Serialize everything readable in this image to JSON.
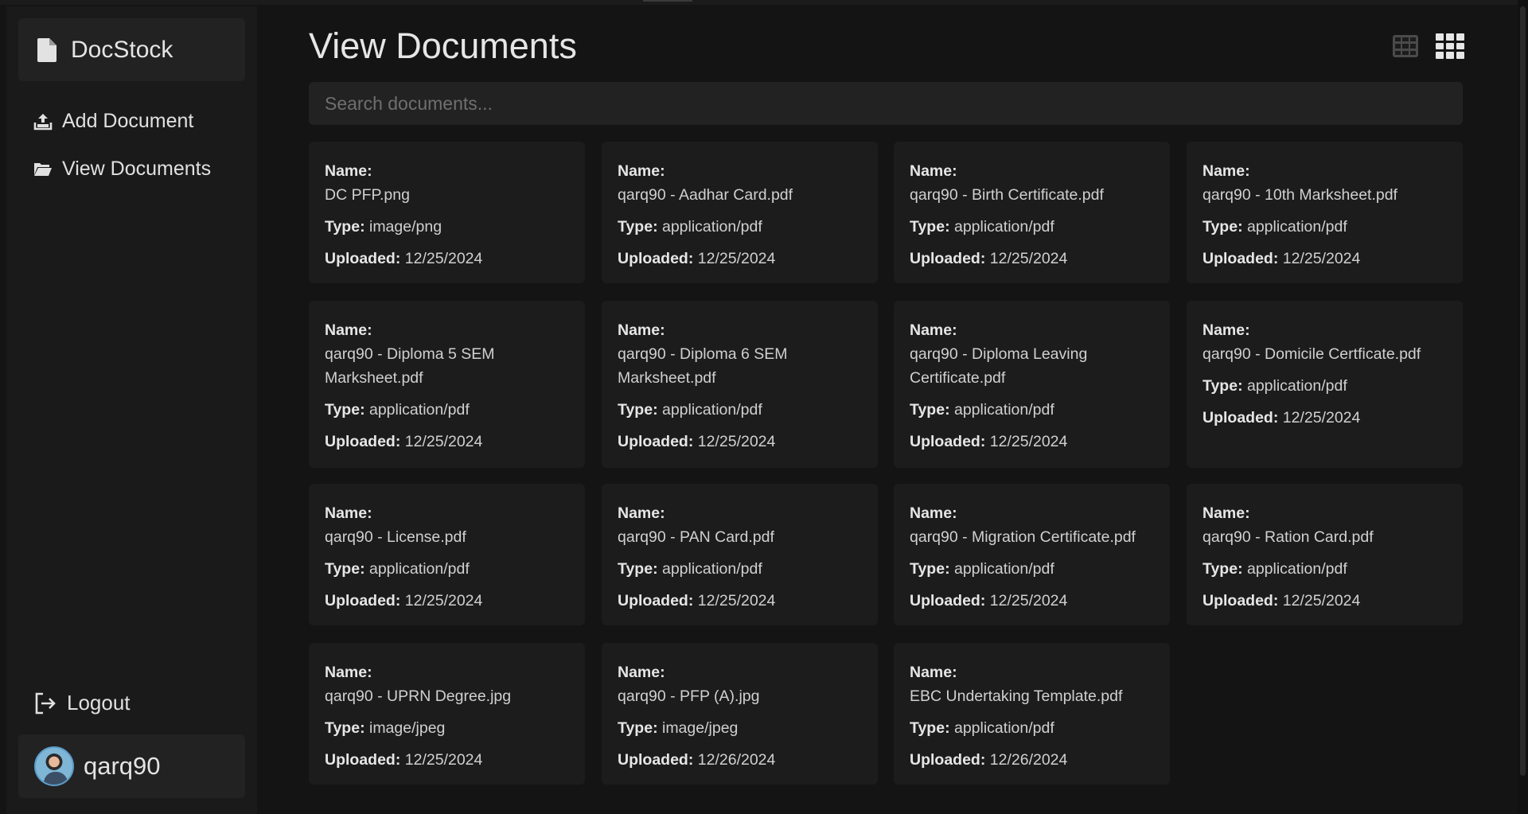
{
  "app": {
    "brand": "DocStock"
  },
  "sidebar": {
    "items": [
      {
        "label": "Add Document",
        "icon": "upload-icon"
      },
      {
        "label": "View Documents",
        "icon": "folder-open-icon"
      }
    ],
    "logout_label": "Logout",
    "user": {
      "name": "qarq90"
    }
  },
  "main": {
    "title": "View Documents",
    "search": {
      "placeholder": "Search documents...",
      "value": ""
    },
    "labels": {
      "name": "Name:",
      "type": "Type:",
      "uploaded": "Uploaded:"
    },
    "documents": [
      {
        "name": "DC PFP.png",
        "type": "image/png",
        "uploaded": "12/25/2024"
      },
      {
        "name": "qarq90 - Aadhar Card.pdf",
        "type": "application/pdf",
        "uploaded": "12/25/2024"
      },
      {
        "name": "qarq90 - Birth Certificate.pdf",
        "type": "application/pdf",
        "uploaded": "12/25/2024"
      },
      {
        "name": "qarq90 - 10th Marksheet.pdf",
        "type": "application/pdf",
        "uploaded": "12/25/2024"
      },
      {
        "name": "qarq90 - Diploma 5 SEM Marksheet.pdf",
        "type": "application/pdf",
        "uploaded": "12/25/2024"
      },
      {
        "name": "qarq90 - Diploma 6 SEM Marksheet.pdf",
        "type": "application/pdf",
        "uploaded": "12/25/2024"
      },
      {
        "name": "qarq90 - Diploma Leaving Certificate.pdf",
        "type": "application/pdf",
        "uploaded": "12/25/2024"
      },
      {
        "name": "qarq90 - Domicile Certficate.pdf",
        "type": "application/pdf",
        "uploaded": "12/25/2024"
      },
      {
        "name": "qarq90 - License.pdf",
        "type": "application/pdf",
        "uploaded": "12/25/2024"
      },
      {
        "name": "qarq90 - PAN Card.pdf",
        "type": "application/pdf",
        "uploaded": "12/25/2024"
      },
      {
        "name": "qarq90 - Migration Certificate.pdf",
        "type": "application/pdf",
        "uploaded": "12/25/2024"
      },
      {
        "name": "qarq90 - Ration Card.pdf",
        "type": "application/pdf",
        "uploaded": "12/25/2024"
      },
      {
        "name": "qarq90 - UPRN Degree.jpg",
        "type": "image/jpeg",
        "uploaded": "12/25/2024"
      },
      {
        "name": "qarq90 - PFP (A).jpg",
        "type": "image/jpeg",
        "uploaded": "12/26/2024"
      },
      {
        "name": "EBC Undertaking Template.pdf",
        "type": "application/pdf",
        "uploaded": "12/26/2024"
      }
    ]
  }
}
